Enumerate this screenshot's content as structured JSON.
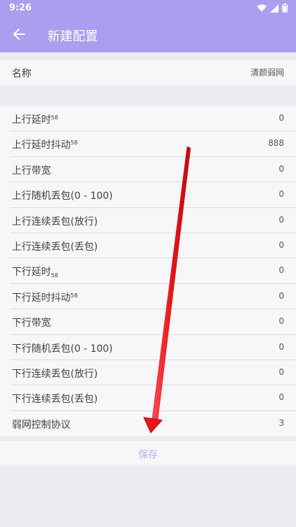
{
  "status": {
    "time": "9:26"
  },
  "header": {
    "title": "新建配置"
  },
  "name_row": {
    "label": "名称",
    "value": "清颜弱网"
  },
  "rows": [
    {
      "label": "上行延时",
      "sup": "58",
      "sub": "",
      "value": "0"
    },
    {
      "label": "上行延时抖动",
      "sup": "58",
      "sub": "",
      "value": "888"
    },
    {
      "label": "上行带宽",
      "sup": "",
      "sub": "",
      "value": "0"
    },
    {
      "label": "上行随机丢包(0 - 100)",
      "sup": "",
      "sub": "",
      "value": "0"
    },
    {
      "label": "上行连续丢包(放行)",
      "sup": "",
      "sub": "",
      "value": "0"
    },
    {
      "label": "上行连续丢包(丢包)",
      "sup": "",
      "sub": "",
      "value": "0"
    },
    {
      "label": "下行延时",
      "sup": "",
      "sub": "58",
      "value": "0"
    },
    {
      "label": "下行延时抖动",
      "sup": "58",
      "sub": "",
      "value": "0"
    },
    {
      "label": "下行带宽",
      "sup": "",
      "sub": "",
      "value": "0"
    },
    {
      "label": "下行随机丢包(0 - 100)",
      "sup": "",
      "sub": "",
      "value": "0"
    },
    {
      "label": "下行连续丢包(放行)",
      "sup": "",
      "sub": "",
      "value": "0"
    },
    {
      "label": "下行连续丢包(丢包)",
      "sup": "",
      "sub": "",
      "value": "0"
    },
    {
      "label": "弱网控制协议",
      "sup": "",
      "sub": "",
      "value": "3"
    }
  ],
  "save": {
    "label": "保存"
  },
  "colors": {
    "appbar": "#a99ef0",
    "save_text": "#b9b0ee",
    "annotation_arrow": "#e8141c"
  }
}
